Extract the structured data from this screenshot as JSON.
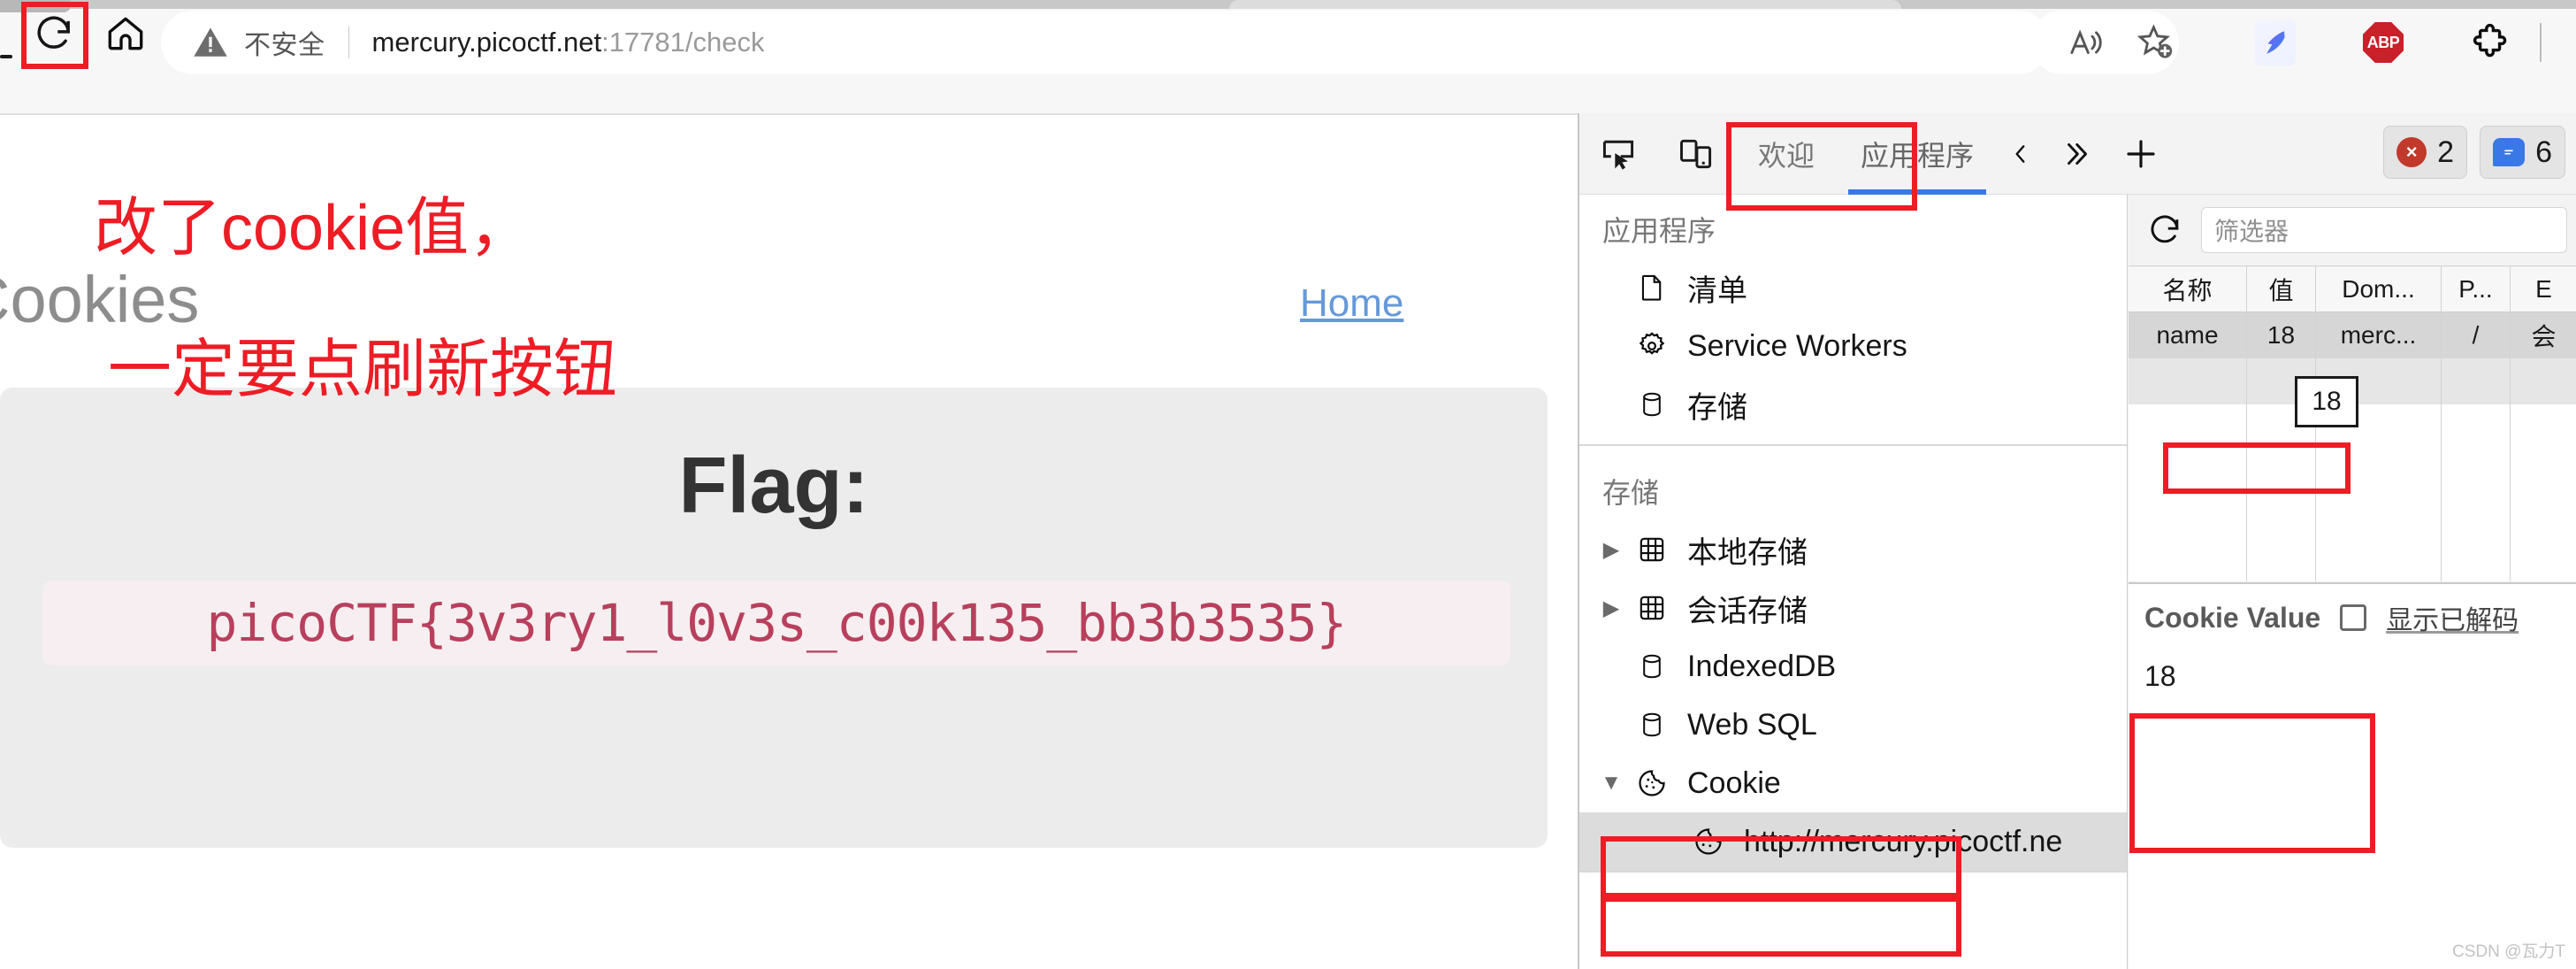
{
  "browser": {
    "reload_icon": "reload-icon",
    "home_icon": "home-icon",
    "security_label": "不安全",
    "url_host": "mercury.picoctf.net",
    "url_rest": ":17781/check",
    "read_aloud_icon": "read-aloud-icon",
    "favorite_icon": "add-favorite-icon",
    "bird_ext_icon": "bird-extension-icon",
    "abp_label": "ABP",
    "puzzle_icon": "extensions-puzzle-icon",
    "collapse_icon": "collapse-chevron-icon"
  },
  "annotations": {
    "line1": "改了cookie值，",
    "line2": "一定要点刷新按钮",
    "color": "#ee1c25"
  },
  "page": {
    "title": "Cookies",
    "home_link": "Home",
    "flag_heading": "Flag:",
    "flag_value": "picoCTF{3v3ry1_l0v3s_c00k135_bb3b3535}",
    "flag_color": "#b8405c"
  },
  "devtools": {
    "toolbar": {
      "inspect_icon": "inspect-element-icon",
      "device_icon": "device-toolbar-icon",
      "tabs": [
        {
          "label": "欢迎",
          "active": false
        },
        {
          "label": "应用程序",
          "active": true
        }
      ],
      "prev_icon": "chevron-left-icon",
      "more_icon": "chevron-double-right-icon",
      "add_icon": "plus-icon",
      "error_count": "2",
      "message_count": "6"
    },
    "sidebar": {
      "sections": [
        {
          "title": "应用程序",
          "items": [
            {
              "label": "清单",
              "icon": "document-icon",
              "arrow": ""
            },
            {
              "label": "Service Workers",
              "icon": "gear-icon",
              "arrow": ""
            },
            {
              "label": "存储",
              "icon": "database-icon",
              "arrow": ""
            }
          ]
        },
        {
          "title": "存储",
          "items": [
            {
              "label": "本地存储",
              "icon": "grid-icon",
              "arrow": "▶"
            },
            {
              "label": "会话存储",
              "icon": "grid-icon",
              "arrow": "▶"
            },
            {
              "label": "IndexedDB",
              "icon": "database-icon",
              "arrow": ""
            },
            {
              "label": "Web SQL",
              "icon": "database-icon",
              "arrow": ""
            },
            {
              "label": "Cookie",
              "icon": "cookie-icon",
              "arrow": "▼"
            },
            {
              "label": "http://mercury.picoctf.ne",
              "icon": "cookie-icon",
              "arrow": "",
              "depth": 2,
              "selected": true
            }
          ]
        }
      ]
    },
    "cookie_panel": {
      "refresh_icon": "refresh-icon",
      "filter_placeholder": "筛选器",
      "columns": [
        "名称",
        "值",
        "Dom...",
        "P...",
        "E"
      ],
      "rows": [
        [
          "name",
          "18",
          "merc...",
          "/",
          "会"
        ]
      ],
      "value_tooltip": "18",
      "detail_title": "Cookie Value",
      "detail_value": "18",
      "show_decoded_label": "显示已解码",
      "watermark": "CSDN @瓦力T"
    }
  }
}
